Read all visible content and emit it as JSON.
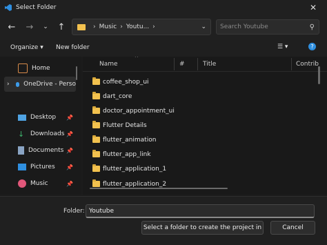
{
  "window": {
    "title": "Select Folder"
  },
  "nav": {
    "breadcrumb": [
      "Music",
      "Youtu..."
    ],
    "search_placeholder": "Search Youtube"
  },
  "toolbar": {
    "organize": "Organize",
    "new_folder": "New folder"
  },
  "sidebar": {
    "items": [
      {
        "label": "Home"
      },
      {
        "label": "OneDrive - Perso"
      },
      {
        "label": "Desktop"
      },
      {
        "label": "Downloads"
      },
      {
        "label": "Documents"
      },
      {
        "label": "Pictures"
      },
      {
        "label": "Music"
      }
    ]
  },
  "columns": {
    "name": "Name",
    "num": "#",
    "title": "Title",
    "contrib": "Contrib"
  },
  "files": [
    "coffee_shop_ui",
    "dart_core",
    "doctor_appointment_ui",
    "Flutter Details",
    "flutter_animation",
    "flutter_app_link",
    "flutter_application_1",
    "flutter_application_2"
  ],
  "footer": {
    "folder_label": "Folder:",
    "folder_value": "Youtube",
    "select_button": "Select a folder to create the project in",
    "cancel_button": "Cancel"
  }
}
